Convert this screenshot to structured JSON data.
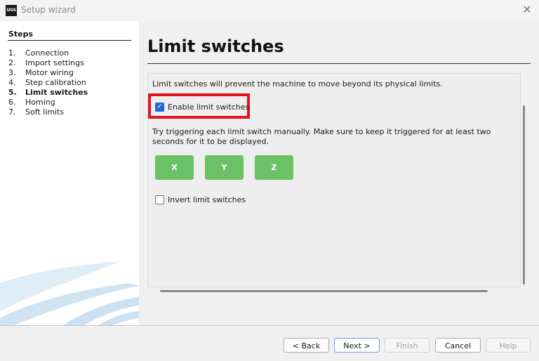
{
  "window": {
    "title": "Setup wizard",
    "icon_text": "UGS",
    "close_glyph": "✕"
  },
  "steps": {
    "heading": "Steps",
    "items": [
      {
        "num": "1.",
        "label": "Connection"
      },
      {
        "num": "2.",
        "label": "Import settings"
      },
      {
        "num": "3.",
        "label": "Motor wiring"
      },
      {
        "num": "4.",
        "label": "Step calibration"
      },
      {
        "num": "5.",
        "label": "Limit switches"
      },
      {
        "num": "6.",
        "label": "Homing"
      },
      {
        "num": "7.",
        "label": "Soft limits"
      }
    ],
    "active_index": 4
  },
  "main": {
    "title": "Limit switches",
    "description": "Limit switches will prevent the machine to move beyond its physical limits.",
    "enable_label": "Enable limit switches",
    "enable_checked": true,
    "instructions": "Try triggering each limit switch manually. Make sure to keep it triggered for at least two seconds for it to be displayed.",
    "axes": [
      "X",
      "Y",
      "Z"
    ],
    "invert_label": "Invert limit switches",
    "invert_checked": false,
    "highlight_color": "#e3141c",
    "axis_button_color": "#6cc167"
  },
  "buttons": {
    "back": "< Back",
    "next": "Next >",
    "finish": "Finish",
    "cancel": "Cancel",
    "help": "Help"
  }
}
